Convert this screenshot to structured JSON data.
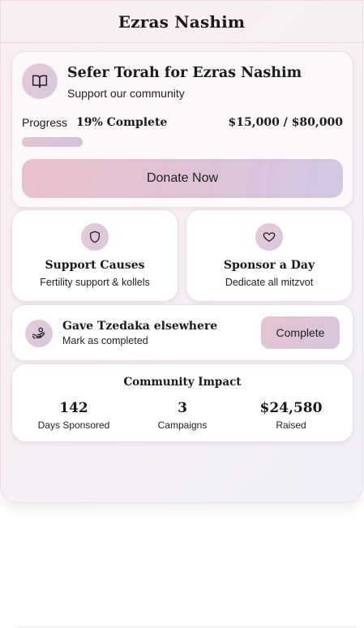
{
  "header": {
    "title": "Ezras Nashim"
  },
  "campaign": {
    "title": "Sefer Torah for Ezras Nashim",
    "subtitle": "Support our community",
    "progress_label": "Progress",
    "progress_text": "19% Complete",
    "progress_fraction": 0.19,
    "raised_goal": "$15,000 / $80,000",
    "donate_label": "Donate Now",
    "icon": "book-icon"
  },
  "actions": [
    {
      "title": "Support Causes",
      "subtitle": "Fertility support & kollels",
      "icon": "shield-icon"
    },
    {
      "title": "Sponsor a Day",
      "subtitle": "Dedicate all mitzvot",
      "icon": "heart-icon"
    }
  ],
  "tzedaka": {
    "title": "Gave Tzedaka elsewhere",
    "subtitle": "Mark as completed",
    "button_label": "Complete",
    "icon": "hand-coin-icon"
  },
  "impact": {
    "title": "Community Impact",
    "stats": [
      {
        "value": "142",
        "label": "Days Sponsored"
      },
      {
        "value": "3",
        "label": "Campaigns"
      },
      {
        "value": "$24,580",
        "label": "Raised"
      }
    ]
  },
  "colors": {
    "accent_pink": "#e8c1cb",
    "accent_lavender": "#d2c6e1",
    "background": "#f6f0f5"
  }
}
